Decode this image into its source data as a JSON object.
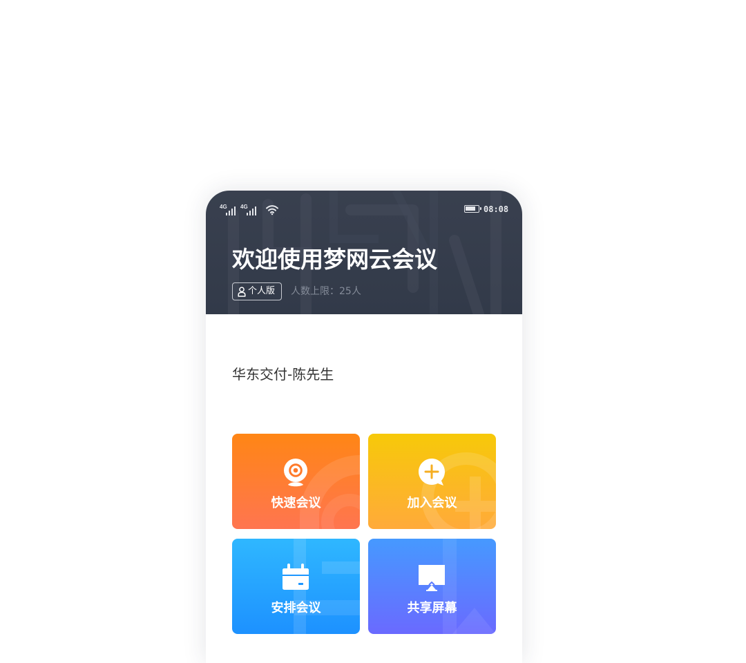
{
  "status_bar": {
    "network_1": "4G",
    "network_2": "4G",
    "time": "08:08",
    "icons": [
      "signal-icon",
      "signal-icon",
      "wifi-icon",
      "battery-icon"
    ]
  },
  "header": {
    "title": "欢迎使用梦网云会议",
    "edition_label": "个人版",
    "edition_icon": "person-outline-icon",
    "limit_text": "人数上限：25人",
    "background_color": "#343b4a"
  },
  "user": {
    "display_name": "华东交付-陈先生"
  },
  "actions": [
    {
      "label": "快速会议",
      "icon": "camera-icon",
      "gradient": [
        "#ff8615",
        "#ff7550"
      ]
    },
    {
      "label": "加入会议",
      "icon": "add-chat-icon",
      "gradient": [
        "#f7c909",
        "#ffaa3a"
      ]
    },
    {
      "label": "安排会议",
      "icon": "calendar-icon",
      "gradient": [
        "#2fb7ff",
        "#1d91ff"
      ]
    },
    {
      "label": "共享屏幕",
      "icon": "screen-share-icon",
      "gradient": [
        "#4699ff",
        "#6a6aff"
      ]
    }
  ]
}
